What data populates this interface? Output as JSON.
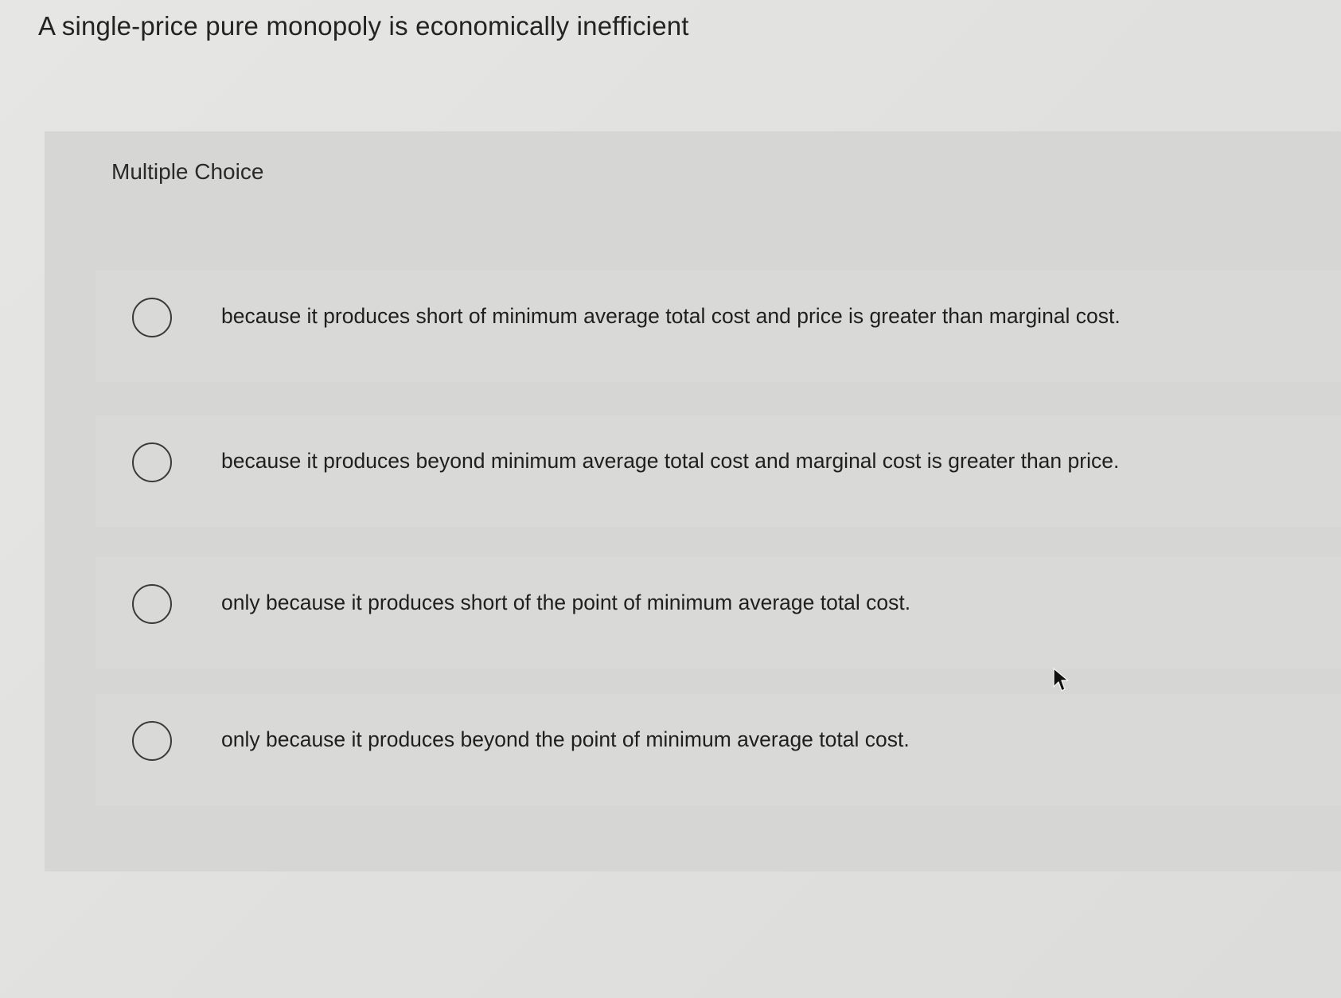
{
  "question": {
    "title": "A single-price pure monopoly is economically inefficient",
    "type_label": "Multiple Choice",
    "choices": [
      {
        "label": "because it produces short of minimum average total cost and price is greater than marginal cost.",
        "selected": false
      },
      {
        "label": "because it produces beyond minimum average total cost and marginal cost is greater than price.",
        "selected": false
      },
      {
        "label": "only because it produces short of the point of minimum average total cost.",
        "selected": false
      },
      {
        "label": "only because it produces beyond the point of minimum average total cost.",
        "selected": false
      }
    ]
  },
  "icons": {
    "radio": "radio-circle-empty",
    "cursor": "mouse-pointer-arrow"
  }
}
